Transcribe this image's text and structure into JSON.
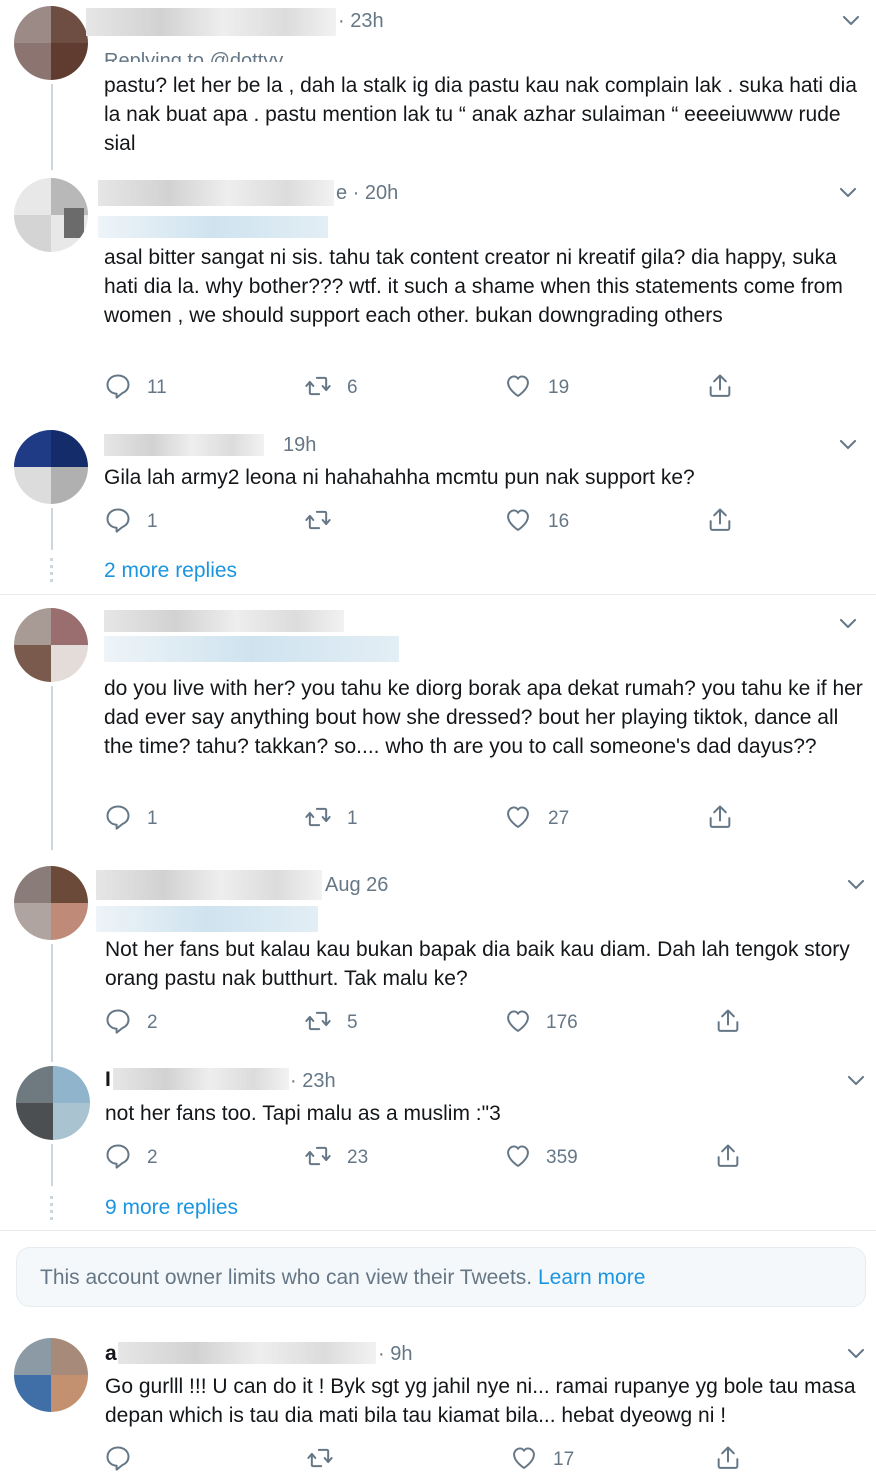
{
  "colors": {
    "text": "#14171a",
    "meta": "#657786",
    "link": "#1b95e0",
    "border": "#e6ecf0",
    "thread": "#ccd6dd"
  },
  "replies": [
    {
      "time": "· 23h",
      "replying": "Replying to @dottyy_",
      "text": "pastu? let her be la , dah la stalk ig dia pastu kau nak complain lak . suka hati dia la nak buat apa . pastu mention lak tu “ anak azhar sulaiman “ eeeeiuwww rude sial"
    },
    {
      "time": "e · 20h",
      "text": "asal bitter sangat ni sis. tahu tak content creator ni kreatif gila? dia happy, suka hati dia la. why bother??? wtf. it such a shame when this statements come from women , we should support each other. bukan downgrading others",
      "reply_count": "11",
      "retweet_count": "6",
      "like_count": "19"
    },
    {
      "time": "19h",
      "text": "Gila lah army2 leona ni hahahahha mcmtu pun nak support ke?",
      "reply_count": "1",
      "retweet_count": "",
      "like_count": "16",
      "more": "2 more replies"
    },
    {
      "time": "",
      "text": "do you live with her? you tahu ke diorg borak apa dekat rumah? you tahu ke if her dad ever say anything bout how she dressed? bout her playing tiktok, dance all the time? tahu? takkan? so.... who th are you to call someone's dad dayus??",
      "reply_count": "1",
      "retweet_count": "1",
      "like_count": "27"
    },
    {
      "time": "Aug 26",
      "text": "Not her fans but kalau kau bukan bapak dia baik kau diam. Dah lah tengok story orang pastu nak butthurt. Tak malu ke?",
      "reply_count": "2",
      "retweet_count": "5",
      "like_count": "176"
    },
    {
      "name_initial": "I",
      "time": "· 23h",
      "text": "not her fans too. Tapi malu as a muslim :\"3",
      "reply_count": "2",
      "retweet_count": "23",
      "like_count": "359",
      "more": "9 more replies"
    },
    {
      "name_initial": "a",
      "time": "· 9h",
      "text": "Go gurlll !!! U can do it ! Byk sgt yg jahil nye ni... ramai rupanye yg bole tau masa depan which is tau dia mati bila tau kiamat bila... hebat dyeowg ni !",
      "reply_count": "",
      "retweet_count": "",
      "like_count": "17"
    }
  ],
  "notice": {
    "text": "This account owner limits who can view their Tweets.",
    "link": "Learn more"
  }
}
